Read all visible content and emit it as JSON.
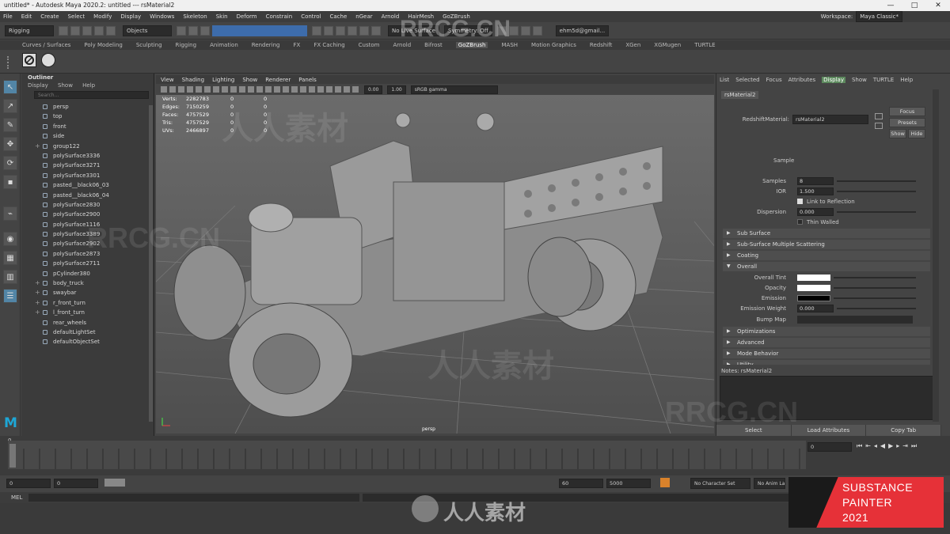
{
  "window": {
    "title": "untitled* - Autodesk Maya 2020.2: untitled   ---   rsMaterial2",
    "controls": [
      "—",
      "□",
      "✕"
    ]
  },
  "menubar": {
    "items": [
      "File",
      "Edit",
      "Create",
      "Select",
      "Modify",
      "Display",
      "Windows",
      "Skeleton",
      "Skin",
      "Deform",
      "Constrain",
      "Control",
      "Cache",
      "nGear",
      "Arnold",
      "HairMesh",
      "GoZBrush"
    ],
    "workspace_label": "Workspace:",
    "workspace_value": "Maya Classic*"
  },
  "statusline": {
    "mode": "Rigging",
    "objects": "Objects",
    "live_surface": "No Live Surface",
    "symmetry": "Symmetry: Off",
    "user": "ehm5d@gmail..."
  },
  "shelf": {
    "tabs": [
      "Curves / Surfaces",
      "Poly Modeling",
      "Sculpting",
      "Rigging",
      "Animation",
      "Rendering",
      "FX",
      "FX Caching",
      "Custom",
      "Arnold",
      "Bifrost",
      "GoZBrush",
      "MASH",
      "Motion Graphics",
      "Redshift",
      "XGen",
      "XGMugen",
      "TURTLE"
    ],
    "active": "GoZBrush"
  },
  "outliner": {
    "title": "Outliner",
    "menu": [
      "Display",
      "Show",
      "Help"
    ],
    "search_placeholder": "Search...",
    "items": [
      "persp",
      "top",
      "front",
      "side",
      "group122",
      "polySurface3336",
      "polySurface3271",
      "polySurface3301",
      "pasted__black06_03",
      "pasted__black06_04",
      "polySurface2830",
      "polySurface2900",
      "polySurface1116",
      "polySurface3389",
      "polySurface2902",
      "polySurface2873",
      "polySurface2711",
      "pCylinder380",
      "body_truck",
      "swaybar",
      "r_front_turn",
      "l_front_turn",
      "rear_wheels",
      "defaultLightSet",
      "defaultObjectSet"
    ]
  },
  "viewport": {
    "menu": [
      "View",
      "Shading",
      "Lighting",
      "Show",
      "Renderer",
      "Panels"
    ],
    "exposure": "0.00",
    "gamma": "1.00",
    "colorspace": "sRGB gamma",
    "hud": [
      {
        "k": "Verts:",
        "v": "2282783",
        "a": "0",
        "b": "0"
      },
      {
        "k": "Edges:",
        "v": "7150259",
        "a": "0",
        "b": "0"
      },
      {
        "k": "Faces:",
        "v": "4757529",
        "a": "0",
        "b": "0"
      },
      {
        "k": "Tris:",
        "v": "4757529",
        "a": "0",
        "b": "0"
      },
      {
        "k": "UVs:",
        "v": "2466897",
        "a": "0",
        "b": "0"
      }
    ],
    "camera": "persp"
  },
  "attribute_editor": {
    "tabs": [
      "List",
      "Selected",
      "Focus",
      "Attributes",
      "Display",
      "Show",
      "TURTLE",
      "Help"
    ],
    "active_tab": "Display",
    "node_tab": "rsMaterial2",
    "material_label": "RedshiftMaterial:",
    "material_value": "rsMaterial2",
    "focus_btn": "Focus",
    "presets_btn": "Presets",
    "show_btn": "Show",
    "hide_btn": "Hide",
    "sample_label": "Sample",
    "samples": "8",
    "samples_label": "Samples",
    "ior_label": "IOR",
    "ior_value": "1.500",
    "link_label": "Link to Reflection",
    "dispersion_label": "Dispersion",
    "dispersion_value": "0.000",
    "thin_label": "Thin Walled",
    "sections_top": [
      "Sub Surface",
      "Sub-Surface Multiple Scattering",
      "Coating",
      "Overall"
    ],
    "overall": {
      "diffuse_label": "Overall Tint",
      "opacity_label": "Opacity",
      "emission_label": "Emission",
      "emission_weight_label": "Emission Weight",
      "emission_weight_value": "0.000",
      "bump_label": "Bump Map",
      "diffuse_color": "#ffffff",
      "opacity_color": "#ffffff",
      "emission_color": "#000000"
    },
    "sections_bottom": [
      "Optimizations",
      "Advanced",
      "Mode Behavior",
      "Utility"
    ],
    "notes_label": "Notes:  rsMaterial2",
    "buttons": [
      "Select",
      "Load Attributes",
      "Copy Tab"
    ]
  },
  "timeline": {
    "current": "0",
    "range_start": "0",
    "range_end": "0",
    "start": "60",
    "end": "5000",
    "character_set": "No Character Set",
    "anim_layer": "No Anim Layer"
  },
  "mel": {
    "label": "MEL"
  },
  "watermark": {
    "site": "RRCG.CN",
    "chinese": "人人素材"
  },
  "badge": {
    "line1": "SUBSTANCE",
    "line2": "PAINTER",
    "line3": "2021",
    "red": "#e63138"
  }
}
